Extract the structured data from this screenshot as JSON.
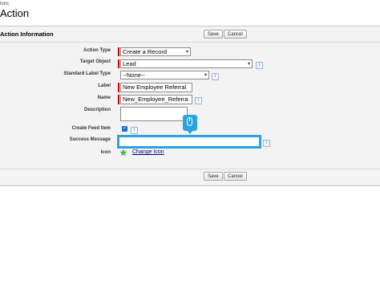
{
  "header": {
    "crumb": "ions",
    "title": "Action"
  },
  "section": {
    "title": "Action Information"
  },
  "buttons": {
    "save_top": "Save",
    "cancel_top": "Cancel",
    "save_bottom": "Save",
    "cancel_bottom": "Cancel"
  },
  "fields": {
    "action_type": {
      "label": "Action Type",
      "value": "Create a Record"
    },
    "target_object": {
      "label": "Target Object",
      "value": "Lead"
    },
    "standard_label_type": {
      "label": "Standard Label Type",
      "value": "--None--"
    },
    "label": {
      "label": "Label",
      "value": "New Employee Referral"
    },
    "name": {
      "label": "Name",
      "value": "New_Employee_Referra"
    },
    "description": {
      "label": "Description",
      "value": ""
    },
    "create_feed_item": {
      "label": "Create Feed Item",
      "checked": true
    },
    "success_message": {
      "label": "Success Message",
      "value": ""
    },
    "icon": {
      "label": "Icon",
      "link": "Change Icon"
    }
  },
  "icons": {
    "info": "i",
    "dropdown": "▾",
    "checkmark": "✓",
    "icon_preview": "star-icon"
  },
  "colors": {
    "required": "#cc0000",
    "focus_highlight": "#2aa3e0",
    "checkbox": "#1a6fd9",
    "link": "#000080"
  }
}
